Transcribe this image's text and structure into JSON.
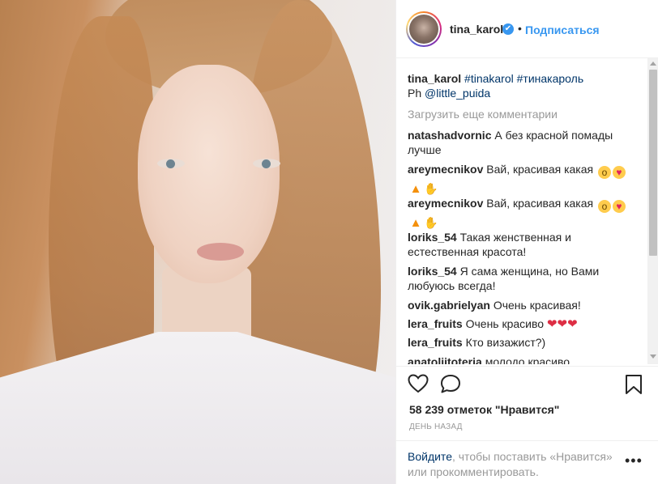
{
  "post": {
    "author": "tina_karol",
    "follow_label": "Подписаться",
    "dot": "•",
    "verified_glyph": "✔"
  },
  "caption": {
    "author": "tina_karol",
    "hashtag1": "#tinakarol",
    "hashtag2": "#тинакароль",
    "credit_prefix": "Ph",
    "credit_mention": "@little_puida"
  },
  "load_more_label": "Загрузить еще комментарии",
  "comments": [
    {
      "user": "natashadvornic",
      "text": "А без красной помады лучше"
    },
    {
      "user": "areymecnikov",
      "text": "Вай, красивая какая"
    },
    {
      "user": "areymecnikov",
      "text": "Вай, красивая какая"
    },
    {
      "user": "loriks_54",
      "text": "Такая женственная и естественная красота!"
    },
    {
      "user": "loriks_54",
      "text": "Я сама женщина, но Вами любуюсь всегда!"
    },
    {
      "user": "ovik.gabrielyan",
      "text": "Очень красивая!"
    },
    {
      "user": "lera_fruits",
      "text": "Очень красиво"
    },
    {
      "user": "lera_fruits",
      "text": "Кто визажист?)"
    },
    {
      "user": "anatolijtoteria",
      "text": "молодо красиво"
    }
  ],
  "icons": {
    "like": "heart-outline-icon",
    "comment": "speech-bubble-icon",
    "save": "bookmark-icon",
    "more": "more-dots-icon"
  },
  "likes_label": "58 239 отметок \"Нравится\"",
  "time_label": "день назад",
  "footer": {
    "login_link": "Войдите",
    "login_text": ", чтобы поставить «Нравится» или прокомментировать.",
    "more_glyph": "•••"
  },
  "colors": {
    "link": "#3897f0",
    "tag": "#003569",
    "muted": "#999999",
    "text": "#262626"
  }
}
